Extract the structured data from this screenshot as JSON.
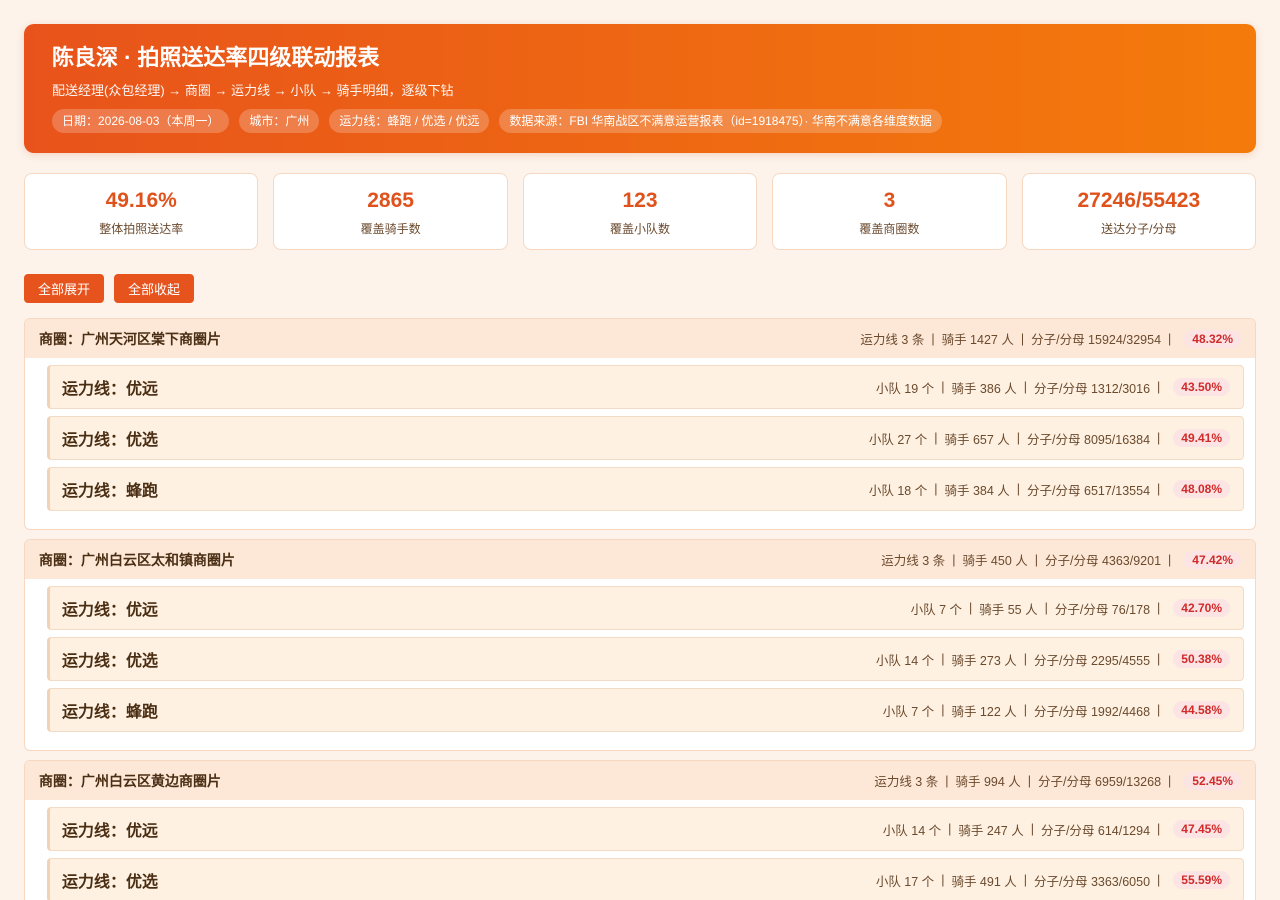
{
  "header": {
    "title": "陈良深 · 拍照送达率四级联动报表",
    "subtitle": "配送经理(众包经理) → 商圈 → 运力线 → 小队 → 骑手明细，逐级下钻",
    "tags": [
      "日期：2026-08-03（本周一）",
      "城市：广州",
      "运力线：蜂跑 / 优选 / 优远",
      "数据来源：FBI 华南战区不满意运营报表（id=1918475）· 华南不满意各维度数据"
    ]
  },
  "kpis": [
    {
      "value": "49.16%",
      "label": "整体拍照送达率"
    },
    {
      "value": "2865",
      "label": "覆盖骑手数"
    },
    {
      "value": "123",
      "label": "覆盖小队数"
    },
    {
      "value": "3",
      "label": "覆盖商圈数"
    },
    {
      "value": "27246/55423",
      "label": "送达分子/分母"
    }
  ],
  "buttons": {
    "expand_all": "全部展开",
    "collapse_all": "全部收起"
  },
  "circles": [
    {
      "name": "商圈：广州天河区棠下商圈片",
      "lines": "运力线 3 条",
      "riders": "骑手 1427 人",
      "ratio": "分子/分母 15924/32954",
      "rate": "48.32%",
      "items": [
        {
          "name": "运力线：优远",
          "teams": "小队 19 个",
          "riders": "骑手 386 人",
          "ratio": "分子/分母 1312/3016",
          "rate": "43.50%"
        },
        {
          "name": "运力线：优选",
          "teams": "小队 27 个",
          "riders": "骑手 657 人",
          "ratio": "分子/分母 8095/16384",
          "rate": "49.41%"
        },
        {
          "name": "运力线：蜂跑",
          "teams": "小队 18 个",
          "riders": "骑手 384 人",
          "ratio": "分子/分母 6517/13554",
          "rate": "48.08%"
        }
      ]
    },
    {
      "name": "商圈：广州白云区太和镇商圈片",
      "lines": "运力线 3 条",
      "riders": "骑手 450 人",
      "ratio": "分子/分母 4363/9201",
      "rate": "47.42%",
      "items": [
        {
          "name": "运力线：优远",
          "teams": "小队 7 个",
          "riders": "骑手 55 人",
          "ratio": "分子/分母 76/178",
          "rate": "42.70%"
        },
        {
          "name": "运力线：优选",
          "teams": "小队 14 个",
          "riders": "骑手 273 人",
          "ratio": "分子/分母 2295/4555",
          "rate": "50.38%"
        },
        {
          "name": "运力线：蜂跑",
          "teams": "小队 7 个",
          "riders": "骑手 122 人",
          "ratio": "分子/分母 1992/4468",
          "rate": "44.58%"
        }
      ]
    },
    {
      "name": "商圈：广州白云区黄边商圈片",
      "lines": "运力线 3 条",
      "riders": "骑手 994 人",
      "ratio": "分子/分母 6959/13268",
      "rate": "52.45%",
      "items": [
        {
          "name": "运力线：优远",
          "teams": "小队 14 个",
          "riders": "骑手 247 人",
          "ratio": "分子/分母 614/1294",
          "rate": "47.45%"
        },
        {
          "name": "运力线：优选",
          "teams": "小队 17 个",
          "riders": "骑手 491 人",
          "ratio": "分子/分母 3363/6050",
          "rate": "55.59%"
        }
      ]
    }
  ]
}
